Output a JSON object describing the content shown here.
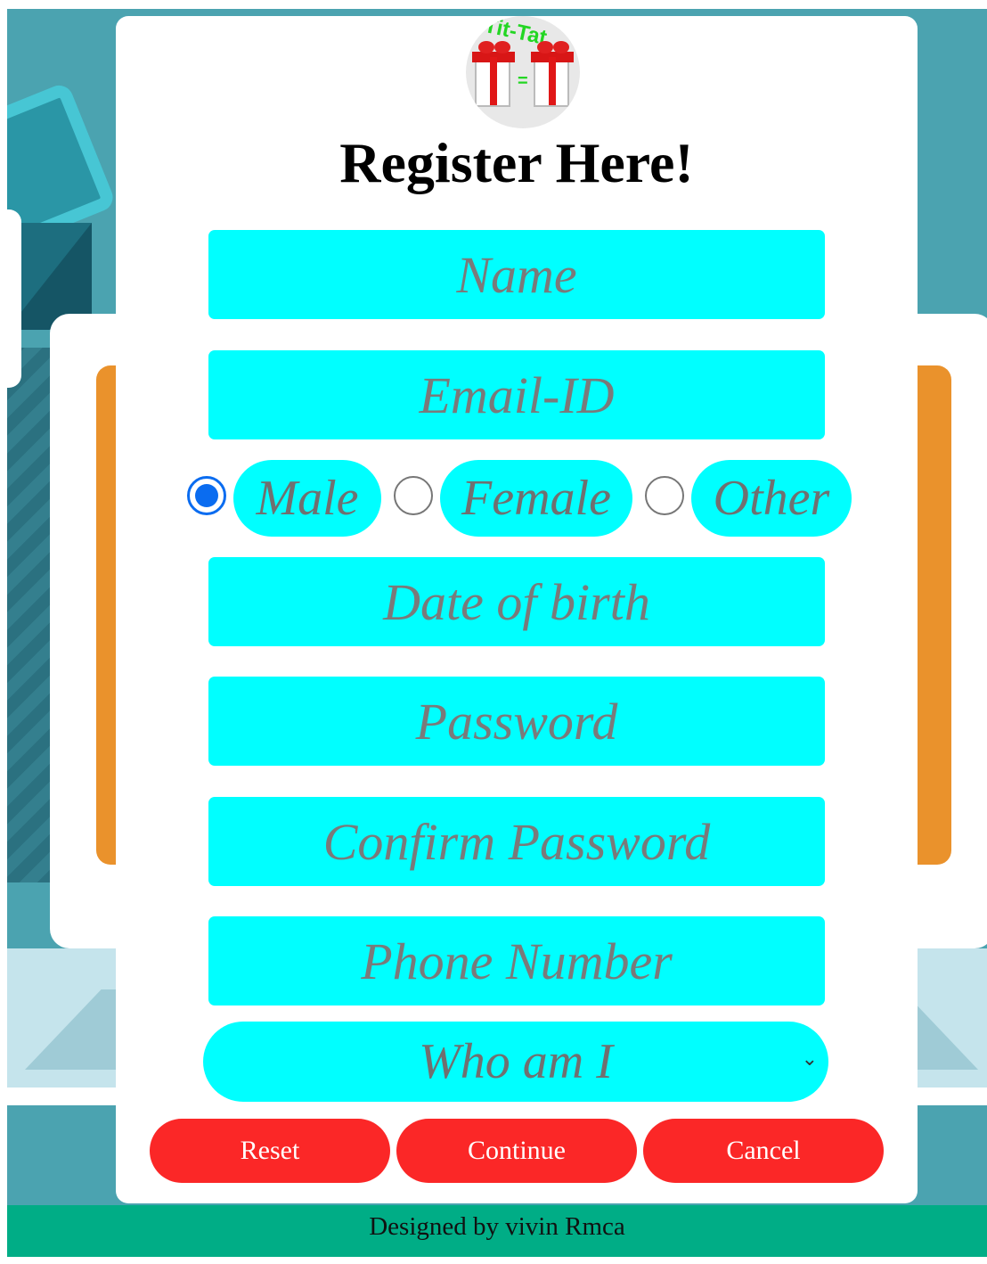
{
  "logo": {
    "text": "Tit-Tat",
    "symbol": "="
  },
  "title": "Register Here!",
  "fields": {
    "name": "Name",
    "email": "Email-ID",
    "dob": "Date of birth",
    "password": "Password",
    "confirm_password": "Confirm Password",
    "phone": "Phone Number"
  },
  "gender": {
    "options": [
      "Male",
      "Female",
      "Other"
    ],
    "selected": "Male"
  },
  "role_select": {
    "value": "Who am I"
  },
  "buttons": {
    "reset": "Reset",
    "continue": "Continue",
    "cancel": "Cancel"
  },
  "footer": "Designed by vivin Rmca",
  "colors": {
    "field_bg": "#00ffff",
    "button_bg": "#fb2727",
    "footer_bg": "#00ad86",
    "background": "#4ba3b0",
    "radio_selected": "#0a6cf0"
  },
  "icons": {
    "select_arrow": "chevron-down-icon",
    "logo": "gift-boxes-logo"
  }
}
